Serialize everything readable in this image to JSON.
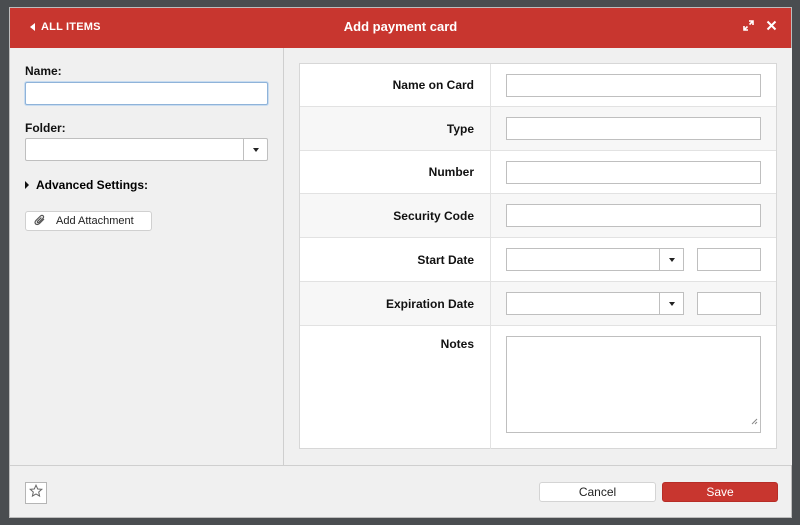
{
  "header": {
    "back_label": "ALL ITEMS",
    "title": "Add payment card",
    "expand_icon": "expand-icon",
    "close_icon": "close-icon",
    "accent_color": "#c8362f"
  },
  "left": {
    "name_label": "Name:",
    "name_value": "",
    "folder_label": "Folder:",
    "folder_value": "",
    "advanced_label": "Advanced Settings:",
    "attach_label": "Add Attachment",
    "attach_icon": "paperclip-icon"
  },
  "form": {
    "name_on_card_label": "Name on Card",
    "type_label": "Type",
    "number_label": "Number",
    "security_code_label": "Security Code",
    "start_date_label": "Start Date",
    "expiration_date_label": "Expiration Date",
    "notes_label": "Notes"
  },
  "footer": {
    "favorite_icon": "star-icon",
    "cancel_label": "Cancel",
    "save_label": "Save"
  }
}
